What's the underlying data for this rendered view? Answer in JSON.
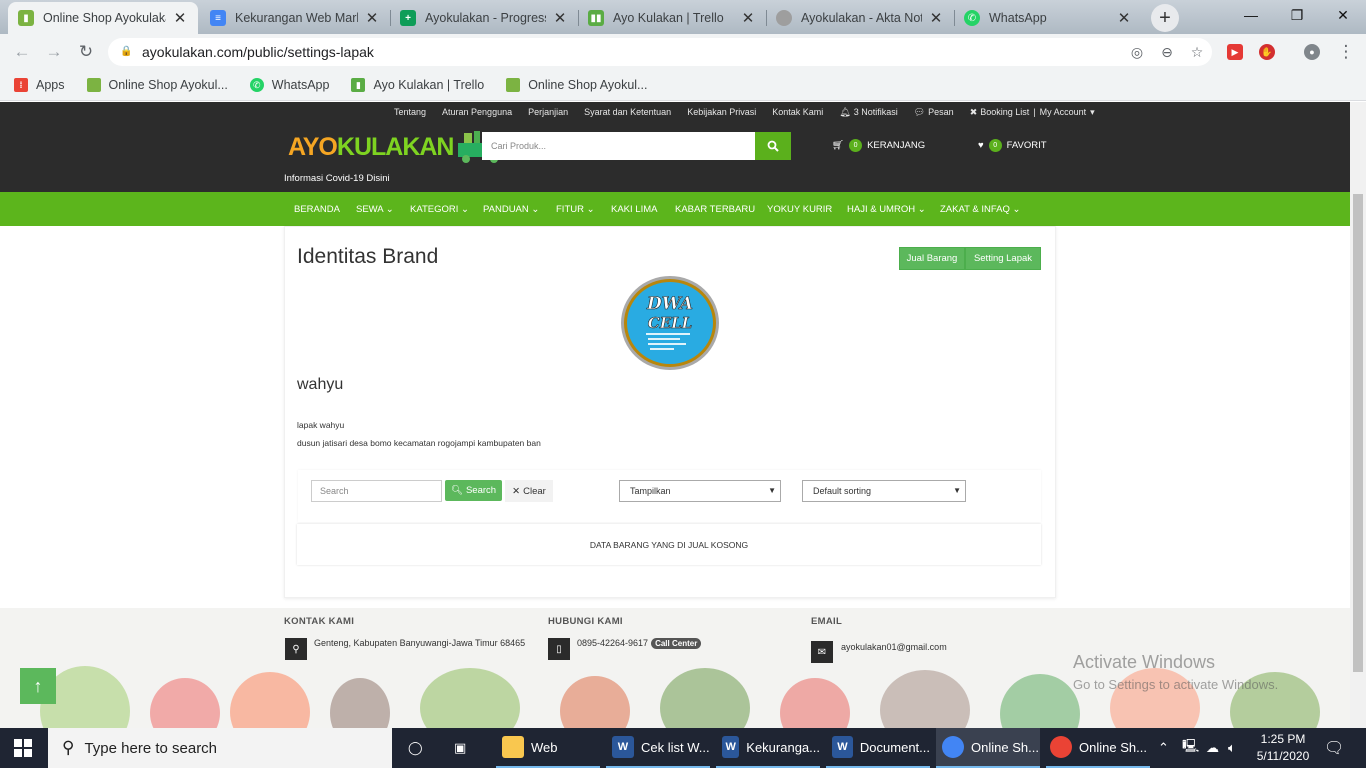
{
  "browser": {
    "tabs": [
      {
        "title": "Online Shop Ayokulakan",
        "active": true
      },
      {
        "title": "Kekurangan Web Market",
        "active": false
      },
      {
        "title": "Ayokulakan - Progress",
        "active": false
      },
      {
        "title": "Ayo Kulakan | Trello",
        "active": false
      },
      {
        "title": "Ayokulakan - Akta Notar",
        "active": false
      },
      {
        "title": "WhatsApp",
        "active": false
      }
    ],
    "url": "ayokulakan.com/public/settings-lapak",
    "bookmarks": [
      "Apps",
      "Online Shop Ayokul...",
      "WhatsApp",
      "Ayo Kulakan | Trello",
      "Online Shop Ayokul..."
    ]
  },
  "site": {
    "top_links": [
      "Tentang",
      "Aturan Pengguna",
      "Perjanjian",
      "Syarat dan Ketentuan",
      "Kebijakan Privasi",
      "Kontak Kami",
      "3 Notifikasi",
      "Pesan",
      "Booking List",
      "My Account"
    ],
    "logo_left": "AYO ",
    "logo_right": "KULAKAN",
    "covid_link": "Informasi Covid-19 Disini",
    "search_placeholder": "Cari Produk...",
    "cart_count": "0",
    "cart_label": "KERANJANG",
    "fav_count": "0",
    "fav_label": "FAVORIT",
    "nav": [
      "BERANDA",
      "SEWA",
      "KATEGORI",
      "PANDUAN",
      "FITUR",
      "KAKI LIMA",
      "KABAR TERBARU",
      "YOKUY KURIR",
      "HAJI & UMROH",
      "ZAKAT & INFAQ"
    ]
  },
  "main": {
    "title": "Identitas Brand",
    "btn_sell": "Jual Barang",
    "btn_setting": "Setting Lapak",
    "brand_logo_text": "DWA CELL",
    "shop_name": "wahyu",
    "shop_desc": "lapak wahyu",
    "shop_address": "dusun jatisari desa bomo kecamatan rogojampi kambupaten ban",
    "search_placeholder": "Search",
    "search_btn": "Search",
    "clear_btn": "Clear",
    "display_select": "Tampilkan",
    "sort_select": "Default sorting",
    "empty_msg": "DATA BARANG YANG DI JUAL KOSONG"
  },
  "footer": {
    "contact_heading": "KONTAK KAMI",
    "contact_text": "Genteng, Kabupaten Banyuwangi-Jawa Timur 68465",
    "phone_heading": "HUBUNGI KAMI",
    "phone_text": "0895-42264-9617",
    "call_badge": "Call Center",
    "email_heading": "EMAIL",
    "email_text": "ayokulakan01@gmail.com"
  },
  "watermark": {
    "line1": "Activate Windows",
    "line2": "Go to Settings to activate Windows."
  },
  "taskbar": {
    "search_placeholder": "Type here to search",
    "apps": [
      "Web",
      "Cek list W...",
      "Kekuranga...",
      "Document...",
      "Online Sh...",
      "Online Sh..."
    ],
    "time": "1:25 PM",
    "date": "5/11/2020"
  }
}
